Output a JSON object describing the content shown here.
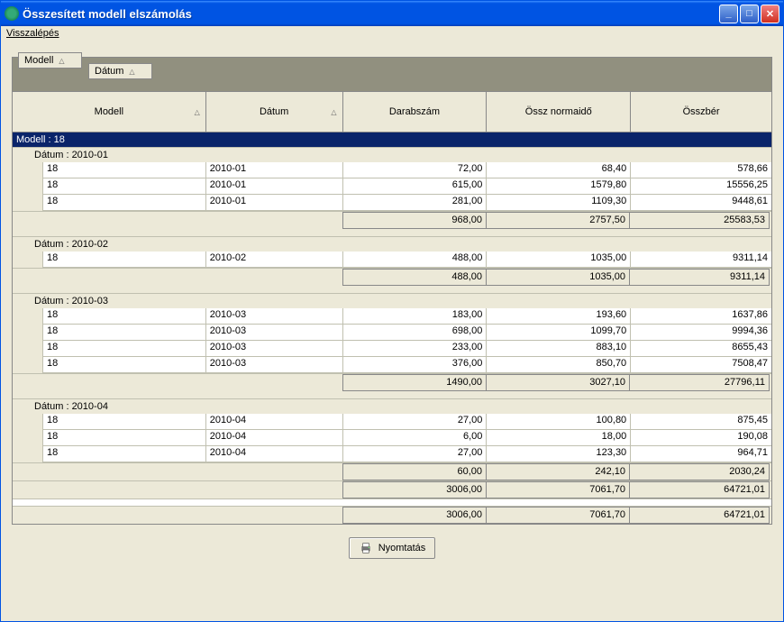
{
  "window": {
    "title": "Összesített modell elszámolás"
  },
  "menu": {
    "back": "Visszalépés"
  },
  "grouping": {
    "box1": "Modell",
    "box2": "Dátum"
  },
  "columns": {
    "c1": "Modell",
    "c2": "Dátum",
    "c3": "Darabszám",
    "c4": "Össz normaidő",
    "c5": "Összbér"
  },
  "topGroup": "Modell : 18",
  "groups": [
    {
      "label": "Dátum : 2010-01",
      "rows": [
        {
          "m": "18",
          "d": "2010-01",
          "qty": "72,00",
          "time": "68,40",
          "wage": "578,66"
        },
        {
          "m": "18",
          "d": "2010-01",
          "qty": "615,00",
          "time": "1579,80",
          "wage": "15556,25"
        },
        {
          "m": "18",
          "d": "2010-01",
          "qty": "281,00",
          "time": "1109,30",
          "wage": "9448,61"
        }
      ],
      "sum": {
        "qty": "968,00",
        "time": "2757,50",
        "wage": "25583,53"
      }
    },
    {
      "label": "Dátum : 2010-02",
      "rows": [
        {
          "m": "18",
          "d": "2010-02",
          "qty": "488,00",
          "time": "1035,00",
          "wage": "9311,14"
        }
      ],
      "sum": {
        "qty": "488,00",
        "time": "1035,00",
        "wage": "9311,14"
      }
    },
    {
      "label": "Dátum : 2010-03",
      "rows": [
        {
          "m": "18",
          "d": "2010-03",
          "qty": "183,00",
          "time": "193,60",
          "wage": "1637,86"
        },
        {
          "m": "18",
          "d": "2010-03",
          "qty": "698,00",
          "time": "1099,70",
          "wage": "9994,36"
        },
        {
          "m": "18",
          "d": "2010-03",
          "qty": "233,00",
          "time": "883,10",
          "wage": "8655,43"
        },
        {
          "m": "18",
          "d": "2010-03",
          "qty": "376,00",
          "time": "850,70",
          "wage": "7508,47"
        }
      ],
      "sum": {
        "qty": "1490,00",
        "time": "3027,10",
        "wage": "27796,11"
      }
    },
    {
      "label": "Dátum : 2010-04",
      "rows": [
        {
          "m": "18",
          "d": "2010-04",
          "qty": "27,00",
          "time": "100,80",
          "wage": "875,45"
        },
        {
          "m": "18",
          "d": "2010-04",
          "qty": "6,00",
          "time": "18,00",
          "wage": "190,08"
        },
        {
          "m": "18",
          "d": "2010-04",
          "qty": "27,00",
          "time": "123,30",
          "wage": "964,71"
        }
      ],
      "sum": {
        "qty": "60,00",
        "time": "242,10",
        "wage": "2030,24"
      }
    }
  ],
  "modelTotal": {
    "qty": "3006,00",
    "time": "7061,70",
    "wage": "64721,01"
  },
  "grandTotal": {
    "qty": "3006,00",
    "time": "7061,70",
    "wage": "64721,01"
  },
  "buttons": {
    "print": "Nyomtatás"
  }
}
